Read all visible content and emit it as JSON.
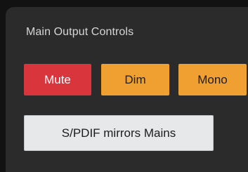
{
  "panel": {
    "title": "Main Output Controls"
  },
  "buttons": {
    "mute": {
      "label": "Mute",
      "color": "#d9353c",
      "active": true
    },
    "dim": {
      "label": "Dim",
      "color": "#f0a030"
    },
    "mono": {
      "label": "Mono",
      "color": "#f0a030"
    },
    "spdif": {
      "label": "S/PDIF mirrors Mains",
      "color": "#e6e8ea"
    }
  }
}
